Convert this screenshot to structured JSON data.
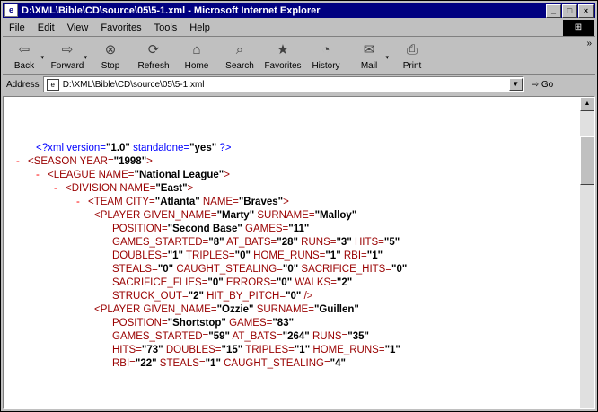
{
  "window": {
    "title": "D:\\XML\\Bible\\CD\\source\\05\\5-1.xml - Microsoft Internet Explorer",
    "buttons": {
      "minimize": "_",
      "maximize": "□",
      "close": "×"
    }
  },
  "menu": [
    "File",
    "Edit",
    "View",
    "Favorites",
    "Tools",
    "Help"
  ],
  "toolbar": [
    {
      "label": "Back",
      "icon": "back-arrow-icon"
    },
    {
      "label": "Forward",
      "icon": "forward-arrow-icon"
    },
    {
      "label": "Stop",
      "icon": "stop-icon"
    },
    {
      "label": "Refresh",
      "icon": "refresh-icon"
    },
    {
      "label": "Home",
      "icon": "home-icon"
    },
    {
      "label": "Search",
      "icon": "search-icon"
    },
    {
      "label": "Favorites",
      "icon": "favorites-icon"
    },
    {
      "label": "History",
      "icon": "history-icon"
    },
    {
      "label": "Mail",
      "icon": "mail-icon"
    },
    {
      "label": "Print",
      "icon": "print-icon"
    }
  ],
  "address": {
    "label": "Address",
    "url": "D:\\XML\\Bible\\CD\\source\\05\\5-1.xml",
    "go": "Go"
  },
  "xml_lines": [
    {
      "prefix": "",
      "text": "<?xml version=\"1.0\" standalone=\"yes\" ?>"
    },
    {
      "prefix": "-",
      "text": "<SEASON YEAR=\"1998\">"
    },
    {
      "prefix": "-",
      "text": "<LEAGUE NAME=\"National League\">"
    },
    {
      "prefix": "-",
      "text": "<DIVISION NAME=\"East\">"
    },
    {
      "prefix": "-",
      "text": "<TEAM CITY=\"Atlanta\" NAME=\"Braves\">"
    },
    {
      "prefix": "",
      "text": "<PLAYER GIVEN_NAME=\"Marty\" SURNAME=\"Malloy\""
    },
    {
      "prefix": "",
      "text": "POSITION=\"Second Base\" GAMES=\"11\""
    },
    {
      "prefix": "",
      "text": "GAMES_STARTED=\"8\" AT_BATS=\"28\" RUNS=\"3\" HITS=\"5\""
    },
    {
      "prefix": "",
      "text": "DOUBLES=\"1\" TRIPLES=\"0\" HOME_RUNS=\"1\" RBI=\"1\""
    },
    {
      "prefix": "",
      "text": "STEALS=\"0\" CAUGHT_STEALING=\"0\" SACRIFICE_HITS=\"0\""
    },
    {
      "prefix": "",
      "text": "SACRIFICE_FLIES=\"0\" ERRORS=\"0\" WALKS=\"2\""
    },
    {
      "prefix": "",
      "text": "STRUCK_OUT=\"2\" HIT_BY_PITCH=\"0\" />"
    },
    {
      "prefix": "",
      "text": "<PLAYER GIVEN_NAME=\"Ozzie\" SURNAME=\"Guillen\""
    },
    {
      "prefix": "",
      "text": "POSITION=\"Shortstop\" GAMES=\"83\""
    },
    {
      "prefix": "",
      "text": "GAMES_STARTED=\"59\" AT_BATS=\"264\" RUNS=\"35\""
    },
    {
      "prefix": "",
      "text": "HITS=\"73\" DOUBLES=\"15\" TRIPLES=\"1\" HOME_RUNS=\"1\""
    },
    {
      "prefix": "",
      "text": "RBI=\"22\" STEALS=\"1\" CAUGHT_STEALING=\"4\""
    }
  ]
}
